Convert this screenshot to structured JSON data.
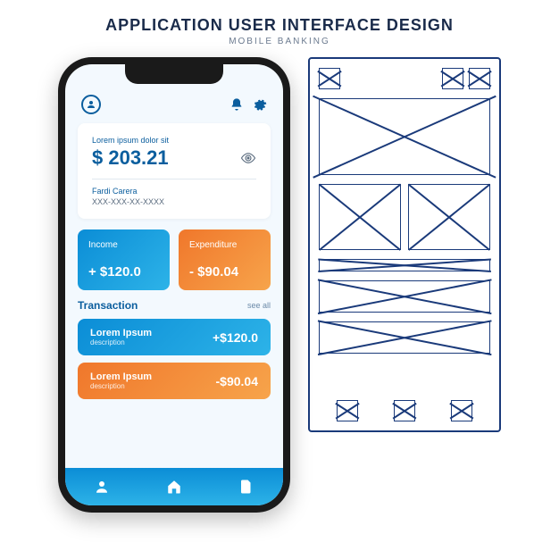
{
  "heading": {
    "title": "APPLICATION USER INTERFACE DESIGN",
    "subtitle": "MOBILE BANKING"
  },
  "balance": {
    "label": "Lorem ipsum dolor sit",
    "amount": "$ 203.21",
    "owner": "Fardi Carera",
    "card_number": "XXX-XXX-XX-XXXX"
  },
  "stats": {
    "income": {
      "label": "Income",
      "value": "+ $120.0"
    },
    "expenditure": {
      "label": "Expenditure",
      "value": "- $90.04"
    }
  },
  "transactions": {
    "title": "Transaction",
    "see_all": "see all",
    "items": [
      {
        "name": "Lorem Ipsum",
        "desc": "description",
        "value": "+$120.0"
      },
      {
        "name": "Lorem Ipsum",
        "desc": "description",
        "value": "-$90.04"
      }
    ]
  }
}
